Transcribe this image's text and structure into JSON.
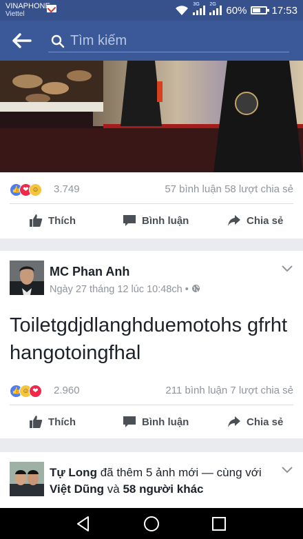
{
  "status_bar": {
    "carrier_1": "VINAPHONE",
    "carrier_2": "Viettel",
    "net_1": "3G",
    "net_2": "2G",
    "battery": "60%",
    "time": "17:53"
  },
  "top_bar": {
    "search_placeholder": "Tìm kiếm"
  },
  "posts": [
    {
      "reaction_count": "3.749",
      "comments": "57 bình luận",
      "shares": "58 lượt chia sẻ",
      "actions": {
        "like": "Thích",
        "comment": "Bình luận",
        "share": "Chia sẻ"
      }
    },
    {
      "author": "MC Phan Anh",
      "meta": "Ngày 27 tháng 12 lúc 10:48ch",
      "separator": "•",
      "text": "Toiletgdjdlanghduemotohs gfrhthangotoingfhal",
      "reaction_count": "2.960",
      "comments": "211 bình luận",
      "shares": "7 lượt chia sẻ",
      "actions": {
        "like": "Thích",
        "comment": "Bình luận",
        "share": "Chia sẻ"
      }
    },
    {
      "author": "Tự Long",
      "action_text": "đã thêm 5 ảnh mới —",
      "with_text": "cùng với",
      "tagged_1": "Việt Dũng",
      "and_text": "và",
      "tagged_2": "58 người",
      "tagged_2_cont": "khác"
    }
  ],
  "colors": {
    "brand": "#3b5998",
    "status_bar": "#36518c",
    "muted": "#90949c"
  },
  "icons": [
    "back-arrow-icon",
    "search-icon",
    "like-icon",
    "comment-icon",
    "share-icon",
    "globe-icon",
    "chevron-down-icon"
  ]
}
